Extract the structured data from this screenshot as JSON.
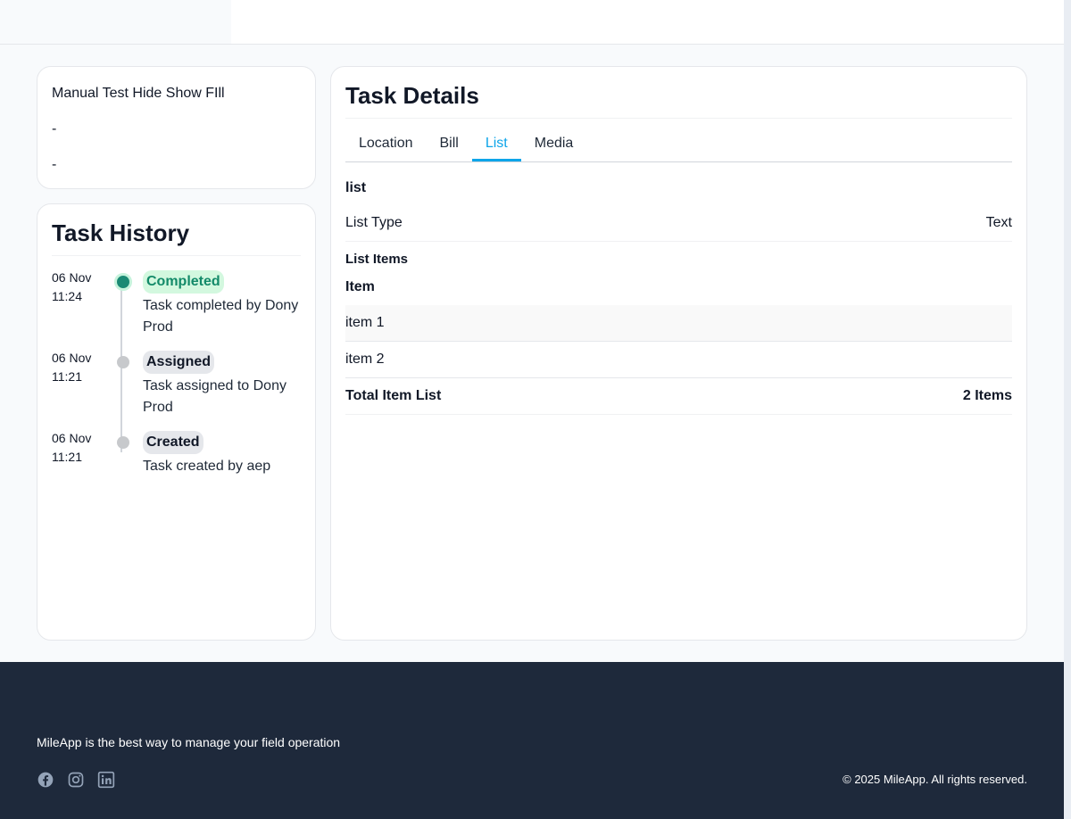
{
  "info": {
    "title": "Manual Test Hide Show FIll",
    "line2": "-",
    "line3": "-"
  },
  "history": {
    "title": "Task History",
    "events": [
      {
        "date": "06 Nov",
        "time": "11:24",
        "status": "Completed",
        "description": "Task completed by Dony Prod"
      },
      {
        "date": "06 Nov",
        "time": "11:21",
        "status": "Assigned",
        "description": "Task assigned to Dony Prod"
      },
      {
        "date": "06 Nov",
        "time": "11:21",
        "status": "Created",
        "description": "Task created by aep"
      }
    ]
  },
  "details": {
    "title": "Task Details",
    "tabs": [
      "Location",
      "Bill",
      "List",
      "Media"
    ],
    "active_tab": "List",
    "section_title": "list",
    "list_type_label": "List Type",
    "list_type_value": "Text",
    "list_items_label": "List Items",
    "item_column": "Item",
    "items": [
      "item 1",
      "item 2"
    ],
    "total_label": "Total Item List",
    "total_value": "2 Items"
  },
  "footer": {
    "tagline": "MileApp is the best way to manage your field operation",
    "copyright": "© 2025 MileApp. All rights reserved.",
    "social_icons": [
      "facebook-icon",
      "instagram-icon",
      "linkedin-icon"
    ]
  },
  "colors": {
    "accent": "#0ea5e9",
    "completed": "#1a8a74",
    "footer_bg": "#1e293b"
  }
}
